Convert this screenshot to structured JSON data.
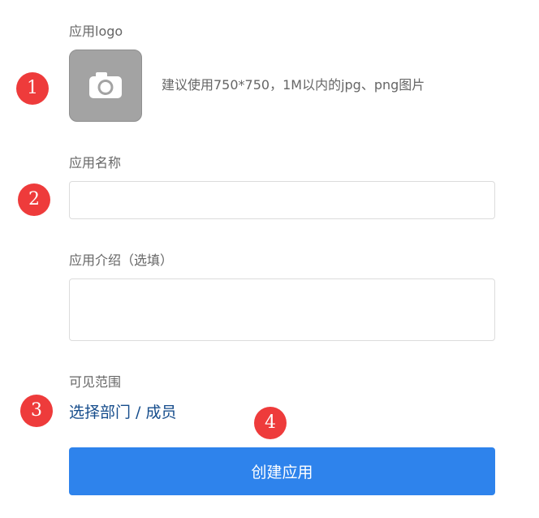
{
  "form": {
    "logo": {
      "label": "应用logo",
      "icon": "camera-icon",
      "hint": "建议使用750*750，1M以内的jpg、png图片",
      "tile_color": "#a3a3a3"
    },
    "name": {
      "label": "应用名称",
      "value": "",
      "placeholder": ""
    },
    "intro": {
      "label": "应用介绍（选填）",
      "value": "",
      "placeholder": ""
    },
    "visibility": {
      "label": "可见范围",
      "link": "选择部门 / 成员",
      "link_color": "#164d8c"
    },
    "submit_label": "创建应用",
    "submit_color": "#2e83ec"
  },
  "markers": {
    "color": "#ee3b3b",
    "items": [
      "1",
      "2",
      "3",
      "4"
    ]
  }
}
